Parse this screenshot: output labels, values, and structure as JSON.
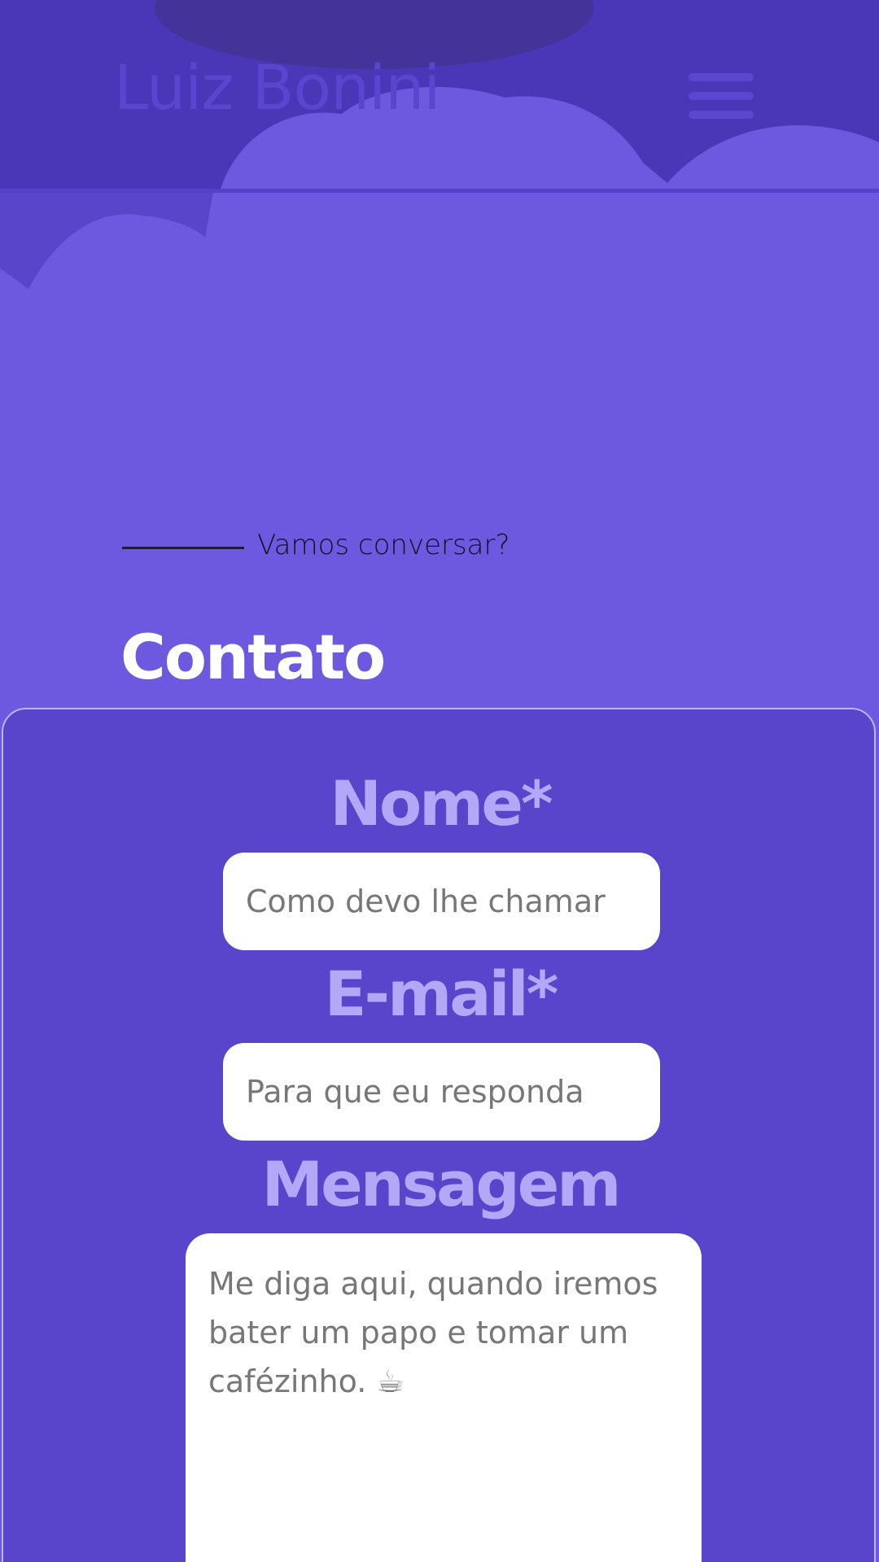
{
  "header": {
    "brand": "Luiz Bonini",
    "menu_icon": "hamburger-menu-icon"
  },
  "section": {
    "eyebrow": "Vamos conversar?",
    "title": "Contato"
  },
  "form": {
    "name_label": "Nome*",
    "name_placeholder": "Como devo lhe chamar",
    "email_label": "E-mail*",
    "email_placeholder": "Para que eu responda",
    "message_label": "Mensagem",
    "message_placeholder": "Me diga aqui, quando iremos bater um papo e tomar um cafézinho. ☕"
  },
  "colors": {
    "background": "#6d59e0",
    "header_dark": "#5541cc",
    "card": "#5845cc",
    "label": "#b3a7f8",
    "title": "#ffffff"
  }
}
